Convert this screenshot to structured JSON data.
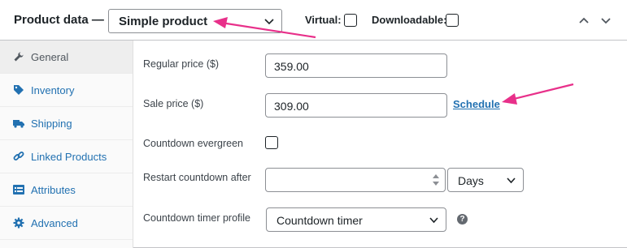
{
  "header": {
    "title": "Product data —",
    "product_type": "Simple product",
    "virtual_label": "Virtual:",
    "downloadable_label": "Downloadable:"
  },
  "sidebar": {
    "items": [
      {
        "label": "General",
        "icon": "wrench-icon"
      },
      {
        "label": "Inventory",
        "icon": "tag-icon"
      },
      {
        "label": "Shipping",
        "icon": "truck-icon"
      },
      {
        "label": "Linked Products",
        "icon": "link-icon"
      },
      {
        "label": "Attributes",
        "icon": "list-icon"
      },
      {
        "label": "Advanced",
        "icon": "gear-icon"
      }
    ]
  },
  "form": {
    "regular_price_label": "Regular price ($)",
    "regular_price_value": "359.00",
    "sale_price_label": "Sale price ($)",
    "sale_price_value": "309.00",
    "schedule_link": "Schedule",
    "countdown_evergreen_label": "Countdown evergreen",
    "restart_countdown_label": "Restart countdown after",
    "restart_countdown_value": "",
    "restart_unit": "Days",
    "timer_profile_label": "Countdown timer profile",
    "timer_profile_value": "Countdown timer"
  },
  "colors": {
    "link": "#2271b1",
    "annotation_arrow": "#e8308a"
  }
}
